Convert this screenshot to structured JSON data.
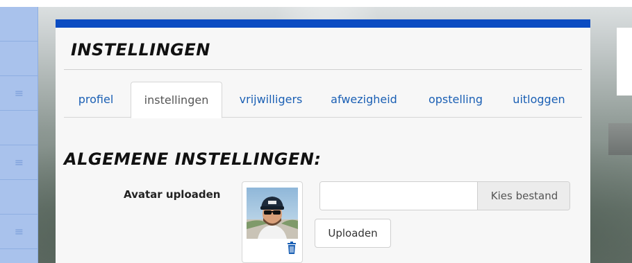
{
  "card": {
    "title": "INSTELLINGEN",
    "tabs": [
      {
        "label": "profiel",
        "active": false
      },
      {
        "label": "instellingen",
        "active": true
      },
      {
        "label": "vrijwilligers",
        "active": false
      },
      {
        "label": "afwezigheid",
        "active": false
      },
      {
        "label": "opstelling",
        "active": false
      },
      {
        "label": "uitloggen",
        "active": false
      }
    ]
  },
  "section": {
    "title": "ALGEMENE INSTELLINGEN:",
    "avatar": {
      "label": "Avatar uploaden",
      "file_value": "",
      "choose_label": "Kies bestand",
      "upload_label": "Uploaden",
      "delete_icon": "trash-icon"
    }
  },
  "nav": {
    "menu_icon": "hamburger-icon"
  },
  "colors": {
    "accent": "#0b4cc2",
    "link": "#1a5fb4",
    "nav_bg": "#a9c2ec"
  }
}
